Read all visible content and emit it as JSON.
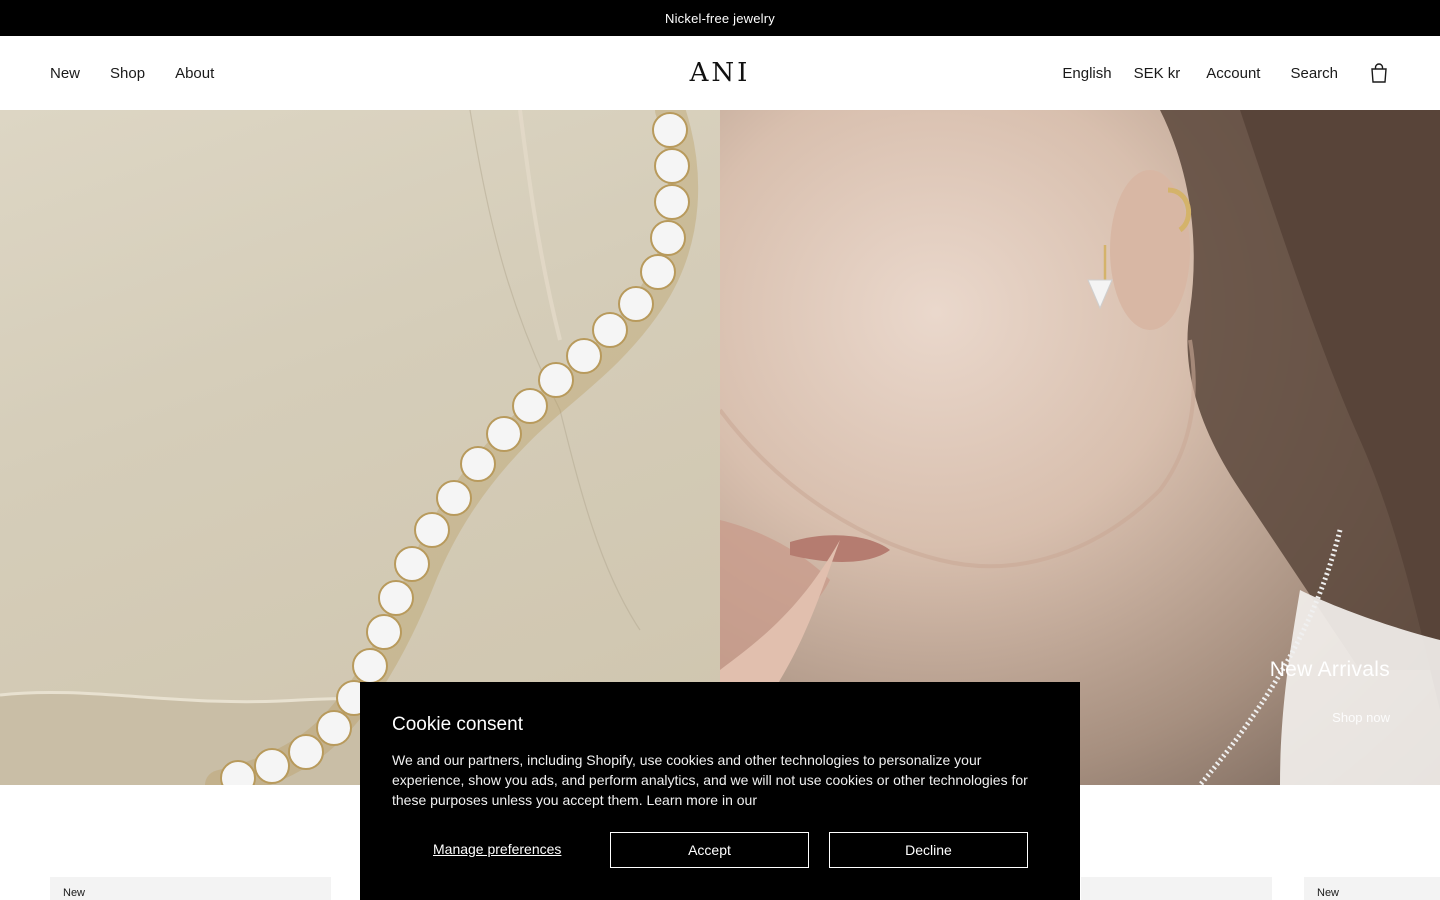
{
  "announcement": {
    "text": "Nickel-free jewelry"
  },
  "header": {
    "logo": "ANI",
    "nav_left": [
      "New",
      "Shop",
      "About"
    ],
    "language": "English",
    "currency": "SEK kr",
    "account": "Account",
    "search": "Search",
    "cart_icon": "shopping-bag-icon"
  },
  "hero": {
    "title": "New Arrivals",
    "link": "Shop now"
  },
  "products": {
    "badge_left": "New",
    "badge_right": "New"
  },
  "cookie": {
    "title": "Cookie consent",
    "body": "We and our partners, including Shopify, use cookies and other technologies to personalize your experience, show you ads, and perform analytics, and we will not use cookies or other technologies for these purposes unless you accept them. Learn more in our",
    "manage_label": "Manage preferences",
    "accept_label": "Accept",
    "decline_label": "Decline"
  }
}
